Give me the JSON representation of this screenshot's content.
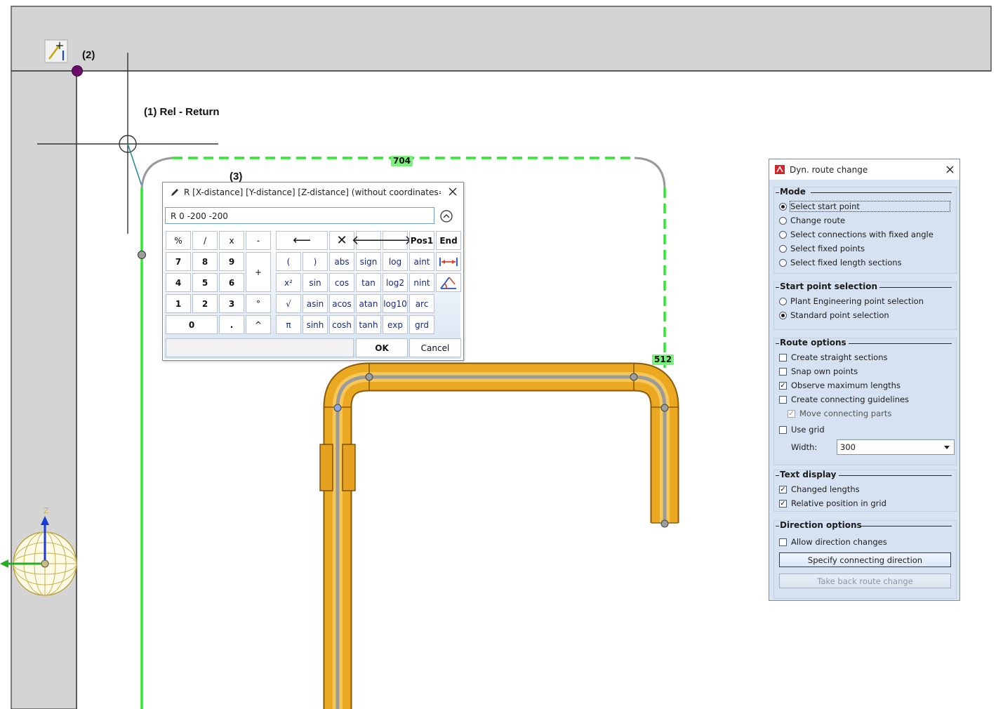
{
  "viewport": {
    "annotations": {
      "step1": "(1) Rel - Return",
      "step2": "(2)",
      "step3": "(3)"
    },
    "dimension_labels": {
      "top_run": "704",
      "right_drop": "512"
    },
    "axis_gizmo": {
      "z_label": "Z",
      "icon": "coordinate-sphere-icon"
    },
    "tool_icon": "point-wand-icon",
    "colors": {
      "route_guide": "#2ee82e",
      "pipe": "#e9a51c",
      "marker": "#6a0d6a",
      "wall": "#d4d4d4"
    }
  },
  "calculator": {
    "title": "R [X-distance] [Y-distance] [Z-distance] (without coordinates=Selec...",
    "input_value": "R 0 -200 -200",
    "keys": {
      "percent": "%",
      "divide": "/",
      "multiply": "x",
      "minus": "-",
      "backspace": "⟵",
      "clear": "✕",
      "left": "🡐",
      "right": "🡒",
      "pos1": "Pos1",
      "end": "End",
      "k7": "7",
      "k8": "8",
      "k9": "9",
      "plus": "+",
      "lparen": "(",
      "rparen": ")",
      "abs": "abs",
      "sign": "sign",
      "log": "log",
      "aint": "aint",
      "k4": "4",
      "k5": "5",
      "k6": "6",
      "square": "x²",
      "sin": "sin",
      "cos": "cos",
      "tan": "tan",
      "log2": "log2",
      "nint": "nint",
      "k1": "1",
      "k2": "2",
      "k3": "3",
      "degree": "°",
      "sqrt": "√",
      "asin": "asin",
      "acos": "acos",
      "atan": "atan",
      "log10": "log10",
      "arc": "arc",
      "k0": "0",
      "dot": ".",
      "power": "^",
      "pi": "π",
      "sinh": "sinh",
      "cosh": "cosh",
      "tanh": "tanh",
      "exp": "exp",
      "grd": "grd"
    },
    "ok": "OK",
    "cancel": "Cancel"
  },
  "panel": {
    "title": "Dyn. route change",
    "mode": {
      "heading": "Mode",
      "options": [
        "Select start point",
        "Change route",
        "Select connections with fixed angle",
        "Select fixed points",
        "Select fixed length sections"
      ],
      "selected": "Select start point"
    },
    "start_point": {
      "heading": "Start point selection",
      "options": [
        "Plant Engineering point selection",
        "Standard point selection"
      ],
      "selected": "Standard point selection"
    },
    "route_options": {
      "heading": "Route options",
      "create_straight": "Create straight sections",
      "snap_own": "Snap own points",
      "observe_max": "Observe maximum lengths",
      "create_guidelines": "Create connecting guidelines",
      "move_parts": "Move connecting parts",
      "use_grid": "Use grid",
      "width_label": "Width:",
      "width_value": "300"
    },
    "text_display": {
      "heading": "Text display",
      "changed_lengths": "Changed lengths",
      "relative_position": "Relative position in grid"
    },
    "direction": {
      "heading": "Direction options",
      "allow_changes": "Allow direction changes",
      "specify_button": "Specify connecting direction",
      "takeback_button": "Take back route change"
    }
  }
}
